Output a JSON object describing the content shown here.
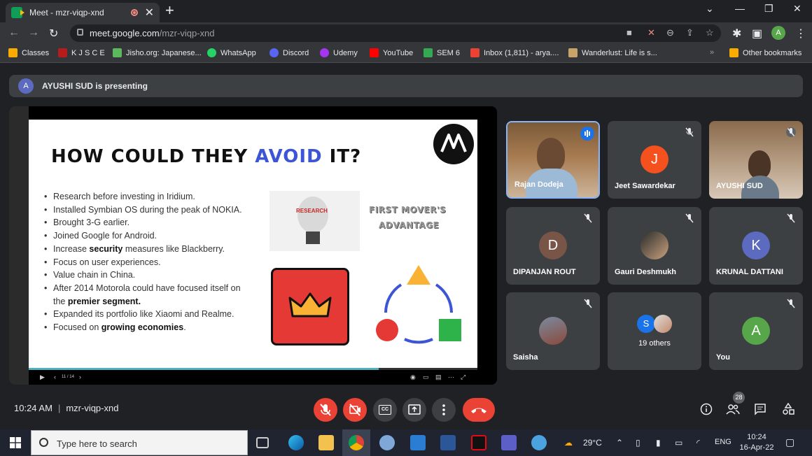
{
  "browser": {
    "tab_title": "Meet - mzr-viqp-xnd",
    "url_host": "meet.google.com",
    "url_path": "/mzr-viqp-xnd",
    "profile_initial": "A"
  },
  "bookmarks": [
    {
      "label": "Classes",
      "color": "#f9ab00"
    },
    {
      "label": "K J S C E",
      "color": "#b71c1c"
    },
    {
      "label": "Jisho.org: Japanese...",
      "color": "#5cb85c"
    },
    {
      "label": "WhatsApp",
      "color": "#25d366"
    },
    {
      "label": "Discord",
      "color": "#5865f2"
    },
    {
      "label": "Udemy",
      "color": "#a435f0"
    },
    {
      "label": "YouTube",
      "color": "#ff0000"
    },
    {
      "label": "SEM 6",
      "color": "#34a853"
    },
    {
      "label": "Inbox (1,811) - arya....",
      "color": "#ea4335"
    },
    {
      "label": "Wanderlust: Life is s...",
      "color": "#c8a46b"
    }
  ],
  "other_bookmarks": "Other bookmarks",
  "presenting": {
    "initial": "A",
    "text": "AYUSHI SUD is presenting"
  },
  "slide": {
    "title_pre": "HOW COULD THEY ",
    "title_hl": "AVOID",
    "title_post": " IT?",
    "bullets": [
      "Research before investing in Iridium.",
      "Installed Symbian OS during the peak of NOKIA.",
      "Brought 3-G earlier.",
      "Joined Google for Android."
    ],
    "b5_pre": "Increase ",
    "b5_bold": "security",
    "b5_post": " measures like Blackberry.",
    "b6": "Focus on user experiences.",
    "b7": "Value chain in China.",
    "b8_line1": "After 2014 Motorola could have focused itself on",
    "b8_pre": "the ",
    "b8_bold": "premier segment.",
    "b9": "Expanded its portfolio like Xiaomi and Realme.",
    "b10_pre": "Focused on ",
    "b10_bold": "growing economies",
    "b10_post": ".",
    "img_research": "RESEARCH",
    "img_fm1": "FIRST MOVER'S",
    "img_fm2": "ADVANTAGE",
    "page": "11 / 14"
  },
  "participants": [
    {
      "name": "Rajan Dodeja",
      "type": "video"
    },
    {
      "name": "Jeet Sawardekar",
      "initial": "J",
      "color": "#f4511e"
    },
    {
      "name": "AYUSHI SUD",
      "type": "video"
    },
    {
      "name": "DIPANJAN ROUT",
      "initial": "D",
      "color": "#795548"
    },
    {
      "name": "Gauri Deshmukh",
      "type": "photo"
    },
    {
      "name": "KRUNAL DATTANI",
      "initial": "K",
      "color": "#5c6bc0"
    },
    {
      "name": "Saisha",
      "type": "photo"
    },
    {
      "name": "19 others",
      "initial": "S"
    },
    {
      "name": "You",
      "initial": "A",
      "color": "#57a64a"
    }
  ],
  "bottom": {
    "time": "10:24 AM",
    "meeting_code": "mzr-viqp-xnd",
    "people_count": "28",
    "cc_label": "CC"
  },
  "taskbar": {
    "search_placeholder": "Type here to search",
    "temp": "29°C",
    "lang": "ENG",
    "time": "10:24",
    "date": "16-Apr-22"
  }
}
